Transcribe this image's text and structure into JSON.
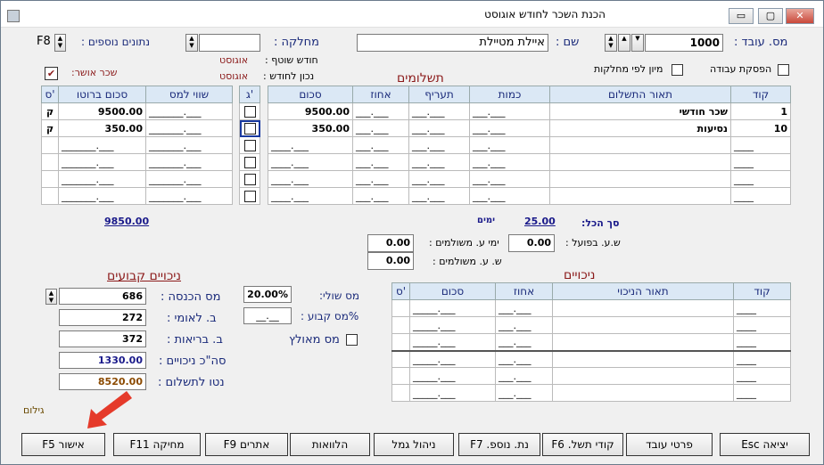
{
  "window": {
    "title": "הכנת השכר לחודש אוגוסט",
    "min_label": "▭",
    "max_label": "▢",
    "close_label": "✕"
  },
  "header": {
    "emp_no_label": "מס. עובד :",
    "emp_no_value": "1000",
    "name_label": "שם :",
    "name_value": "איילת מטיילת",
    "dept_label": "מחלקה :",
    "dept_value": "",
    "extra_label": "נתונים נוספים :",
    "extra_key": "F8",
    "stop_work_label": "הפסקת עבודה",
    "sort_label": "מיון לפי מחלקות",
    "joint_month_label": "חודש שוטף :",
    "joint_month_value": "אוגוסט",
    "correct_month_label": "נכון לחודש :",
    "correct_month_value": "אוגוסט",
    "approved_label": "שכר אושר:",
    "approved_check": "✔"
  },
  "payments": {
    "title": "תשלומים",
    "columns": [
      "קוד",
      "תאור התשלום",
      "כמות",
      "תעריף",
      "אחוז",
      "סכום"
    ],
    "rows": [
      {
        "code": "1",
        "desc": "שכר חודשי",
        "qty": "___.___",
        "rate": "___.___",
        "pct": "___.___",
        "amount": "9500.00"
      },
      {
        "code": "10",
        "desc": "נסיעות",
        "qty": "___.___",
        "rate": "___.___",
        "pct": "___.___",
        "amount": "350.00"
      },
      {
        "code": "____",
        "desc": "",
        "qty": "___.___",
        "rate": "___.___",
        "pct": "___.___",
        "amount": "____.___"
      },
      {
        "code": "____",
        "desc": "",
        "qty": "___.___",
        "rate": "___.___",
        "pct": "___.___",
        "amount": "____.___"
      },
      {
        "code": "____",
        "desc": "",
        "qty": "___.___",
        "rate": "___.___",
        "pct": "___.___",
        "amount": "____.___"
      },
      {
        "code": "____",
        "desc": "",
        "qty": "___.___",
        "rate": "___.___",
        "pct": "___.___",
        "amount": "____.___"
      }
    ],
    "g_col": "ג'",
    "right_columns": [
      "שווי למס",
      "סכום ברוטו",
      "ס'"
    ],
    "right_rows": [
      {
        "tax": "_______.___",
        "gross": "9500.00",
        "s": "ק"
      },
      {
        "tax": "_______.___",
        "gross": "350.00",
        "s": "ק"
      },
      {
        "tax": "_______.___",
        "gross": "_______.___",
        "s": ""
      },
      {
        "tax": "_______.___",
        "gross": "_______.___",
        "s": ""
      },
      {
        "tax": "_______.___",
        "gross": "_______.___",
        "s": ""
      },
      {
        "tax": "_______.___",
        "gross": "_______.___",
        "s": ""
      }
    ],
    "total_gross": "9850.00",
    "total_label": "סך הכל:",
    "total_value": "25.00",
    "days_label": "ימים"
  },
  "hours": {
    "actual_label": "ש.ע. בפועל :",
    "actual_value": "0.00",
    "paid_days_label": "ימי ע. משולמים :",
    "paid_days_value": "0.00",
    "paid_hours_label": "ש. ע. משולמים :",
    "paid_hours_value": "0.00"
  },
  "deductions": {
    "title": "ניכויים",
    "columns": [
      "קוד",
      "תאור הניכוי",
      "אחוז",
      "סכום",
      "ס'"
    ],
    "rows": [
      {
        "code": "____",
        "desc": "",
        "pct": "___.___",
        "amount": "_____.___"
      },
      {
        "code": "____",
        "desc": "",
        "pct": "___.___",
        "amount": "_____.___"
      },
      {
        "code": "____",
        "desc": "",
        "pct": "___.___",
        "amount": "_____.___"
      },
      {
        "code": "____",
        "desc": "",
        "pct": "___.___",
        "amount": "_____.___"
      },
      {
        "code": "____",
        "desc": "",
        "pct": "___.___",
        "amount": "_____.___"
      },
      {
        "code": "____",
        "desc": "",
        "pct": "___.___",
        "amount": "_____.___"
      }
    ]
  },
  "fixed": {
    "title": "ניכויים קבועים",
    "income_tax_label": "מס הכנסה :",
    "income_tax_value": "686",
    "bl_label": "ב. לאומי :",
    "bl_value": "272",
    "health_label": "ב. בריאות :",
    "health_value": "372",
    "total_ded_label": "סה\"כ ניכויים :",
    "total_ded_value": "1330.00",
    "net_label": "נטו לתשלום :",
    "net_value": "8520.00",
    "marginal_label": "מס שולי:",
    "marginal_value": "20.00%",
    "fixed_pct_label": "%מס קבוע :",
    "fixed_pct_value": "__.__",
    "mas_meulatz_label": "מס מאולץ"
  },
  "giloum": "גילום",
  "buttons": {
    "approve": "אישור F5",
    "delete": "מחיקה F11",
    "search": "אתרים F9",
    "loans": "הלוואות",
    "pension": "ניהול גמל",
    "extra": "נת. נוספ. F7",
    "pay_codes": "קודי תשל. F6",
    "employee": "פרטי עובד",
    "exit": "יציאה Esc"
  }
}
